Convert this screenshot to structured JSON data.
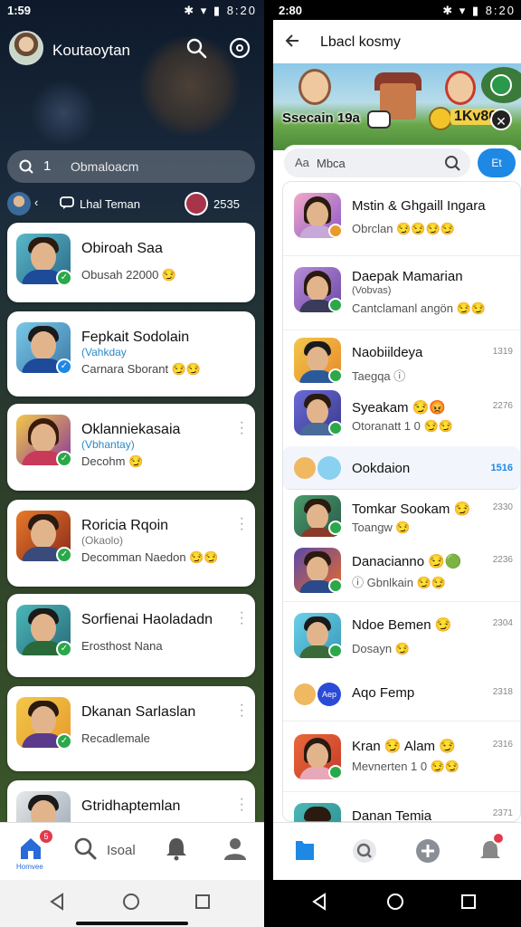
{
  "left": {
    "status": {
      "time": "1:59",
      "icons": "✱ ▾ ▮ 8:20"
    },
    "header": {
      "title": "Koutaoytan"
    },
    "search": {
      "cursor": "1",
      "text": "Obmaloacm"
    },
    "sub": {
      "back": "‹",
      "label": "Lhal Teman",
      "count": "2535"
    },
    "cards": [
      {
        "name": "Obiroah Saa",
        "tag": "",
        "msg": "Obusah 22000 😏"
      },
      {
        "name": "Fepkait Sodolain",
        "tag": "(Vahkday",
        "msg": "Carnara Sborant 😏😏"
      },
      {
        "name": "Oklanniekasaia",
        "tag": "(Vbhantay)",
        "msg": "Decohm 😏"
      },
      {
        "name": "Roricia Rqoin",
        "tag": "(Okaolo)",
        "msg": "Decomman Naedon 😏😏"
      },
      {
        "name": "Sorfienai Haoladadn",
        "tag": "",
        "msg": "Erosthost Nana"
      },
      {
        "name": "Dkanan Sarlaslan",
        "tag": "",
        "msg": "Recadlemale"
      },
      {
        "name": "Gtridhaptemlan",
        "tag": "",
        "msg": ""
      }
    ],
    "nav": {
      "home_label": "Homvee",
      "badge": "5",
      "search_label": "Isoal"
    }
  },
  "right": {
    "status": {
      "time": "2:80",
      "icons": "✱ ▾ ▮ 8:20"
    },
    "header": {
      "title": "Lbacl kosmy"
    },
    "banner": {
      "score": "Ssecain 19a",
      "gold": "1Kv86"
    },
    "search": {
      "prefix": "Aa",
      "text": "Mbca",
      "button": "Et"
    },
    "rows": [
      {
        "name": "Mstin & Ghgaill Ingara",
        "msg": "Obrclan 😏😏😏😏",
        "time": ""
      },
      {
        "name": "Daepak Mamarian",
        "tag": "(Vobvas)",
        "msg": "Cantclamanl angön 😏😏",
        "time": ""
      },
      {
        "name": "Naobiildeya",
        "msg": "Taegqa ⓘ",
        "time": "1319"
      },
      {
        "name": "Syeakam 😏😡",
        "msg": "Otoranatt 1 0 😏😏",
        "time": "2276"
      },
      {
        "name": "Ookdaion",
        "msg": "",
        "time": "1516"
      },
      {
        "name": "Tomkar Sookam 😏",
        "msg": "Toangw 😏",
        "time": "2330"
      },
      {
        "name": "Danacianno 😏🟢",
        "msg": "ⓘ Gbnlkain 😏😏",
        "time": "2236"
      },
      {
        "name": "Ndoe Bemen 😏",
        "msg": "Dosayn 😏",
        "time": "2304"
      },
      {
        "name": "Aqo Femp",
        "msg": "",
        "time": "2318",
        "mini": "Aep"
      },
      {
        "name": "Kran 😏 Alam 😏",
        "msg": "Mevnerten 1 0 😏😏",
        "time": "2316"
      },
      {
        "name": "Danan Temia",
        "msg": "",
        "time": "2371"
      }
    ]
  },
  "colors": {
    "accent": "#1e88e5",
    "badge": "#e23a4a",
    "verified": "#2aa84a"
  }
}
